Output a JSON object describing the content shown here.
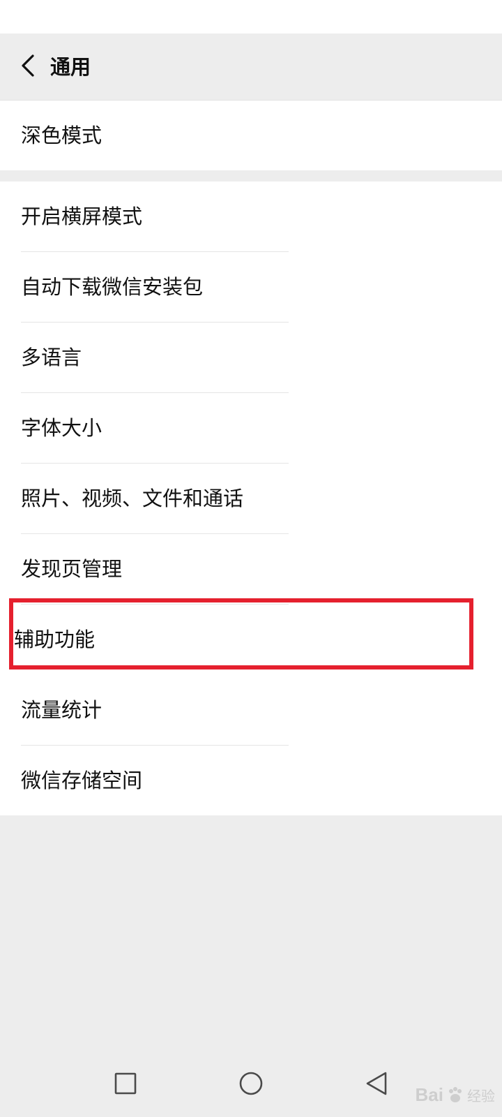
{
  "header": {
    "title": "通用"
  },
  "groups": [
    {
      "items": [
        {
          "label": "深色模式"
        }
      ]
    },
    {
      "items": [
        {
          "label": "开启横屏模式"
        },
        {
          "label": "自动下载微信安装包"
        },
        {
          "label": "多语言"
        },
        {
          "label": "字体大小"
        },
        {
          "label": "照片、视频、文件和通话"
        },
        {
          "label": "发现页管理"
        },
        {
          "label": "辅助功能",
          "highlighted": true
        },
        {
          "label": "流量统计"
        },
        {
          "label": "微信存储空间"
        }
      ]
    }
  ],
  "highlight_color": "#e5202e",
  "navigation_bar": {
    "buttons": [
      "recent-apps",
      "home",
      "back"
    ]
  },
  "watermark": {
    "text": "Bai",
    "text_suffix": "经验"
  }
}
